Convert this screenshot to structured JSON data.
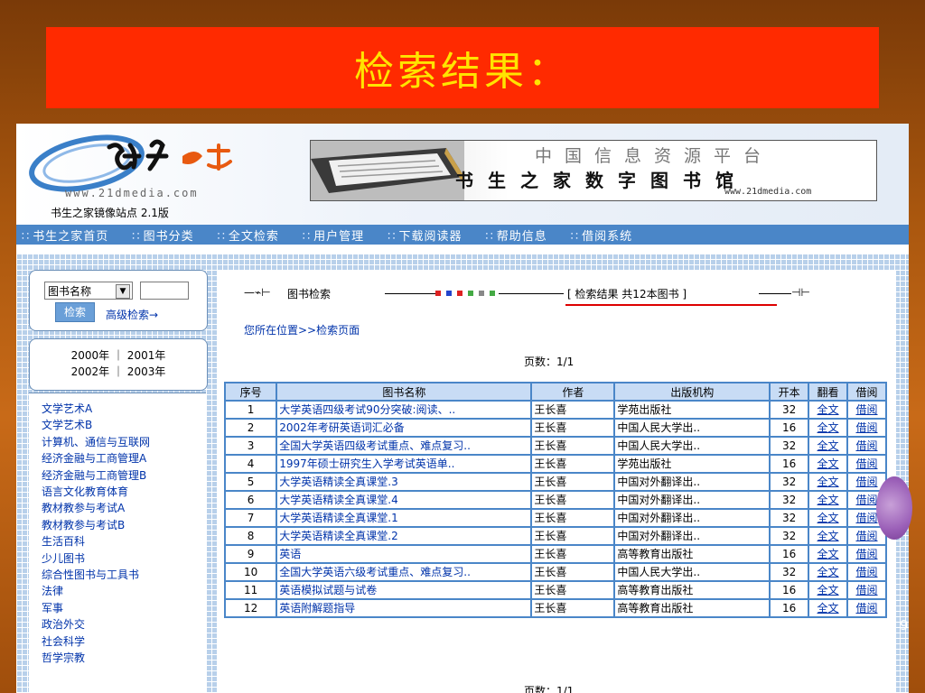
{
  "slide_title": "检索结果：",
  "header": {
    "logo_url": "www.21dmedia.com",
    "mirror_text": "书生之家镜像站点 2.1版",
    "banner_line1": "中国信息资源平台",
    "banner_line2": "书生之家数字图书馆",
    "banner_url": "www.21dmedia.com"
  },
  "nav": {
    "items": [
      "书生之家首页",
      "图书分类",
      "全文检索",
      "用户管理",
      "下载阅读器",
      "帮助信息",
      "借阅系统"
    ]
  },
  "search": {
    "select_value": "图书名称",
    "search_button": "检索",
    "advanced_link": "高级检索→"
  },
  "years": {
    "row1": "2000年 ｜ 2001年",
    "row2": "2002年 ｜ 2003年"
  },
  "categories": [
    "文学艺术A",
    "文学艺术B",
    "计算机、通信与互联网",
    "经济金融与工商管理A",
    "经济金融与工商管理B",
    "语言文化教育体育",
    "教材教参与考试A",
    "教材教参与考试B",
    "生活百科",
    "少儿图书",
    "综合性图书与工具书",
    "法律",
    "军事",
    "政治外交",
    "社会科学",
    "哲学宗教"
  ],
  "flow": {
    "step1": "图书检索",
    "result": "[ 检索结果 共12本图书       ]"
  },
  "location": "您所在位置>>检索页面",
  "pages": "页数：1/1",
  "pages_bottom": "页数：1/1",
  "table": {
    "headers": [
      "序号",
      "图书名称",
      "作者",
      "出版机构",
      "开本",
      "翻看",
      "借阅"
    ],
    "rows": [
      {
        "no": "1",
        "title": "大学英语四级考试90分突破:阅读、..",
        "author": "王长喜",
        "publisher": "学苑出版社",
        "size": "32",
        "view": "全文",
        "borrow": "借阅"
      },
      {
        "no": "2",
        "title": "2002年考研英语词汇必备",
        "author": "王长喜",
        "publisher": "中国人民大学出..",
        "size": "16",
        "view": "全文",
        "borrow": "借阅"
      },
      {
        "no": "3",
        "title": "全国大学英语四级考试重点、难点复习..",
        "author": "王长喜",
        "publisher": "中国人民大学出..",
        "size": "32",
        "view": "全文",
        "borrow": "借阅"
      },
      {
        "no": "4",
        "title": "1997年硕士研究生入学考试英语单..",
        "author": "王长喜",
        "publisher": "学苑出版社",
        "size": "16",
        "view": "全文",
        "borrow": "借阅"
      },
      {
        "no": "5",
        "title": "大学英语精读全真课堂.3",
        "author": "王长喜",
        "publisher": "中国对外翻译出..",
        "size": "32",
        "view": "全文",
        "borrow": "借阅"
      },
      {
        "no": "6",
        "title": "大学英语精读全真课堂.4",
        "author": "王长喜",
        "publisher": "中国对外翻译出..",
        "size": "32",
        "view": "全文",
        "borrow": "借阅"
      },
      {
        "no": "7",
        "title": "大学英语精读全真课堂.1",
        "author": "王长喜",
        "publisher": "中国对外翻译出..",
        "size": "32",
        "view": "全文",
        "borrow": "借阅"
      },
      {
        "no": "8",
        "title": "大学英语精读全真课堂.2",
        "author": "王长喜",
        "publisher": "中国对外翻译出..",
        "size": "32",
        "view": "全文",
        "borrow": "借阅"
      },
      {
        "no": "9",
        "title": "英语",
        "author": "王长喜",
        "publisher": "高等教育出版社",
        "size": "16",
        "view": "全文",
        "borrow": "借阅"
      },
      {
        "no": "10",
        "title": "全国大学英语六级考试重点、难点复习..",
        "author": "王长喜",
        "publisher": "中国人民大学出..",
        "size": "32",
        "view": "全文",
        "borrow": "借阅"
      },
      {
        "no": "11",
        "title": "英语模拟试题与试卷",
        "author": "王长喜",
        "publisher": "高等教育出版社",
        "size": "16",
        "view": "全文",
        "borrow": "借阅"
      },
      {
        "no": "12",
        "title": "英语附解题指导",
        "author": "王长喜",
        "publisher": "高等教育出版社",
        "size": "16",
        "view": "全文",
        "borrow": "借阅"
      }
    ]
  },
  "badge": "9",
  "colors": {
    "title_bg": "#ff2a00",
    "title_text": "#ffe400",
    "nav_bg": "#4a86c8",
    "link": "#0033aa"
  }
}
